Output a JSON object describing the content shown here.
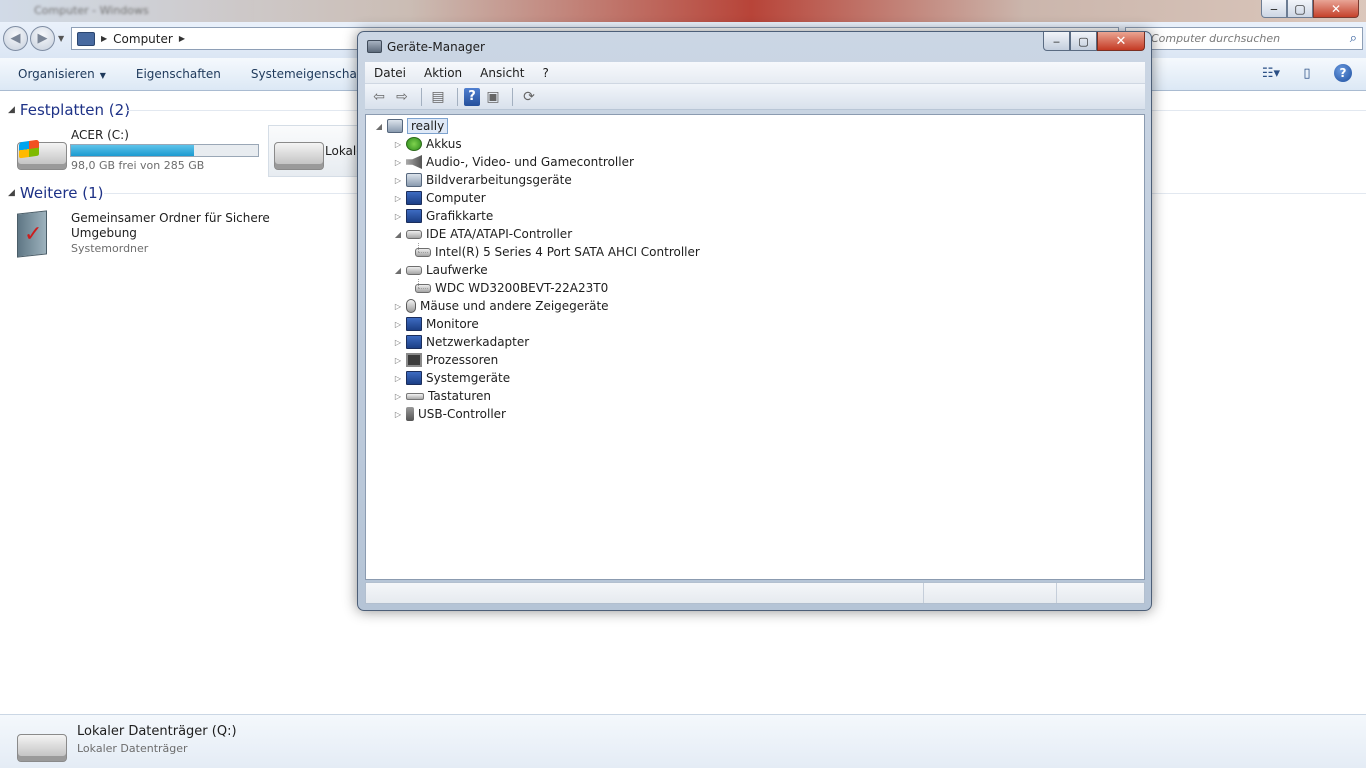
{
  "explorer": {
    "title": "Computer - Windows",
    "window_buttons": {
      "minimize": "‒",
      "maximize": "▢",
      "close": "✕"
    },
    "address": {
      "path": "Computer"
    },
    "search": {
      "placeholder": "Computer durchsuchen"
    },
    "toolbar": {
      "organize": "Organisieren",
      "properties": "Eigenschaften",
      "system_properties": "Systemeigenschaften"
    },
    "groups": {
      "hard_disks": {
        "title": "Festplatten (2)",
        "drives": [
          {
            "name": "ACER (C:)",
            "free_text": "98,0 GB frei von 285 GB",
            "used_fraction": 0.656
          },
          {
            "name": "Lokaler Datenträger (Q:)"
          }
        ]
      },
      "other": {
        "title": "Weitere (1)",
        "items": [
          {
            "name": "Gemeinsamer Ordner für Sichere Umgebung",
            "type": "Systemordner"
          }
        ]
      }
    },
    "details": {
      "name": "Lokaler Datenträger (Q:)",
      "type": "Lokaler Datenträger"
    }
  },
  "device_manager": {
    "title": "Geräte-Manager",
    "window_buttons": {
      "minimize": "‒",
      "maximize": "▢",
      "close": "✕"
    },
    "menu": [
      "Datei",
      "Aktion",
      "Ansicht",
      "?"
    ],
    "toolbar_icons": [
      "back-icon",
      "forward-icon",
      "tree-view-icon",
      "help-icon",
      "properties-icon",
      "scan-hardware-icon"
    ],
    "tree": {
      "root": "really",
      "categories": [
        {
          "label": "Akkus",
          "expanded": false
        },
        {
          "label": "Audio-, Video- und Gamecontroller",
          "expanded": false
        },
        {
          "label": "Bildverarbeitungsgeräte",
          "expanded": false
        },
        {
          "label": "Computer",
          "expanded": false
        },
        {
          "label": "Grafikkarte",
          "expanded": false
        },
        {
          "label": "IDE ATA/ATAPI-Controller",
          "expanded": true,
          "children": [
            "Intel(R) 5 Series 4 Port SATA AHCI Controller"
          ]
        },
        {
          "label": "Laufwerke",
          "expanded": true,
          "children": [
            "WDC WD3200BEVT-22A23T0"
          ]
        },
        {
          "label": "Mäuse und andere Zeigegeräte",
          "expanded": false
        },
        {
          "label": "Monitore",
          "expanded": false
        },
        {
          "label": "Netzwerkadapter",
          "expanded": false
        },
        {
          "label": "Prozessoren",
          "expanded": false
        },
        {
          "label": "Systemgeräte",
          "expanded": false
        },
        {
          "label": "Tastaturen",
          "expanded": false
        },
        {
          "label": "USB-Controller",
          "expanded": false
        }
      ]
    },
    "glyphs": {
      "collapsed": "▷",
      "expanded": "◢"
    }
  }
}
